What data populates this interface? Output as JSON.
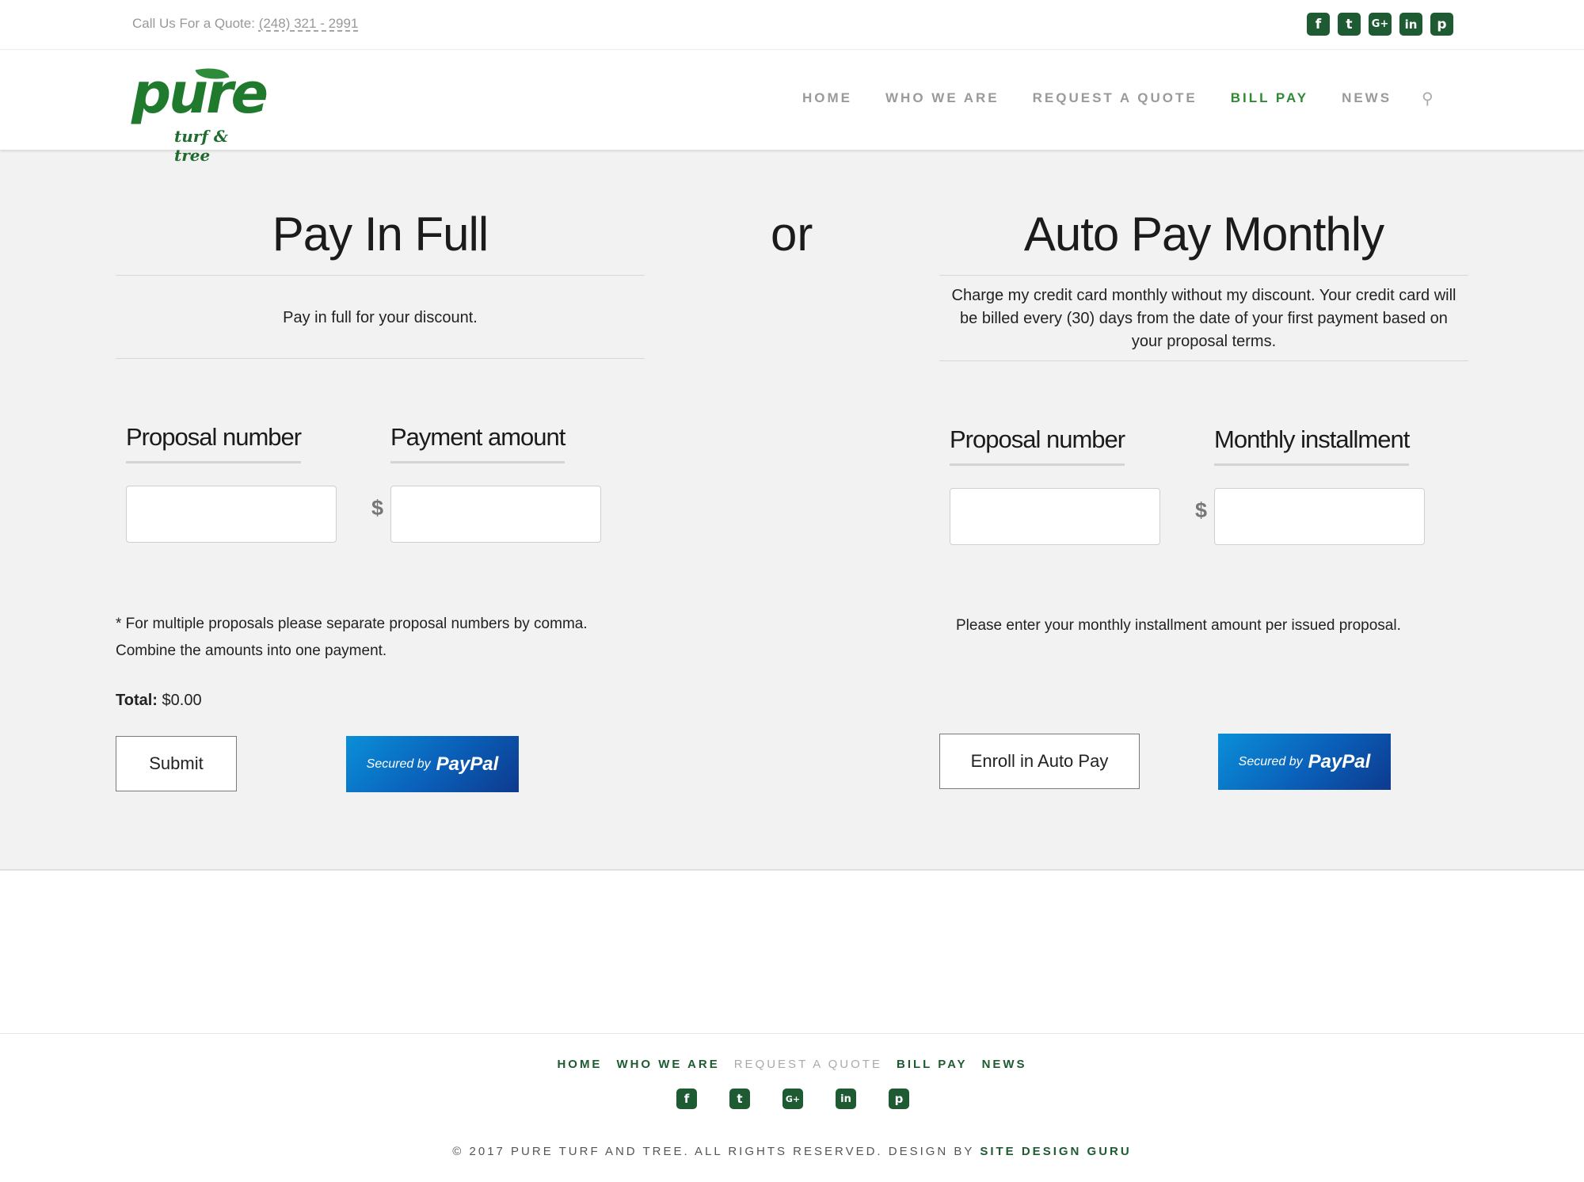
{
  "topbar": {
    "phone_label": "Call Us For a Quote:",
    "phone_number": "(248) 321 - 2991",
    "social": [
      {
        "icon": "facebook-icon",
        "glyph": "f"
      },
      {
        "icon": "twitter-icon",
        "glyph": "t"
      },
      {
        "icon": "google-plus-icon",
        "glyph": "G+"
      },
      {
        "icon": "linkedin-icon",
        "glyph": "in"
      },
      {
        "icon": "pinterest-icon",
        "glyph": "p"
      }
    ]
  },
  "logo": {
    "word": "pure",
    "tagline": "turf & tree"
  },
  "nav": {
    "items": [
      "HOME",
      "WHO WE ARE",
      "REQUEST A QUOTE",
      "BILL PAY",
      "NEWS"
    ],
    "active": "BILL PAY",
    "search_icon": "search-icon"
  },
  "pay_full": {
    "title": "Pay In Full",
    "description": "Pay in full for your discount.",
    "proposal_label": "Proposal number",
    "amount_label": "Payment amount",
    "currency": "$",
    "note_line1": "* For multiple proposals please separate proposal numbers by comma.",
    "note_line2": "Combine the amounts into one payment.",
    "total_label": "Total:",
    "total_value": "$0.00",
    "submit_label": "Submit",
    "paypal_secured": "Secured by",
    "paypal_brand": "PayPal"
  },
  "separator": "or",
  "auto_pay": {
    "title": "Auto Pay Monthly",
    "description_line1": "Charge my credit card monthly without my discount. Your credit card will",
    "description_line2": "be billed every (30) days from the date of your first payment based on",
    "description_line3": "your proposal terms.",
    "proposal_label": "Proposal number",
    "installment_label": "Monthly installment",
    "currency": "$",
    "note": "Please enter your monthly installment amount per issued proposal.",
    "enroll_label": "Enroll in Auto Pay",
    "paypal_secured": "Secured by",
    "paypal_brand": "PayPal"
  },
  "footer": {
    "nav": [
      "HOME",
      "WHO WE ARE",
      "REQUEST A QUOTE",
      "BILL PAY",
      "NEWS"
    ],
    "copyright": "© 2017 PURE TURF AND TREE. ALL RIGHTS RESERVED. DESIGN BY",
    "designer": "SITE DESIGN GURU"
  },
  "colors": {
    "brand_green": "#2f8a33",
    "dark_green": "#1e5a32",
    "paypal_blue": "#0a5fb8"
  }
}
